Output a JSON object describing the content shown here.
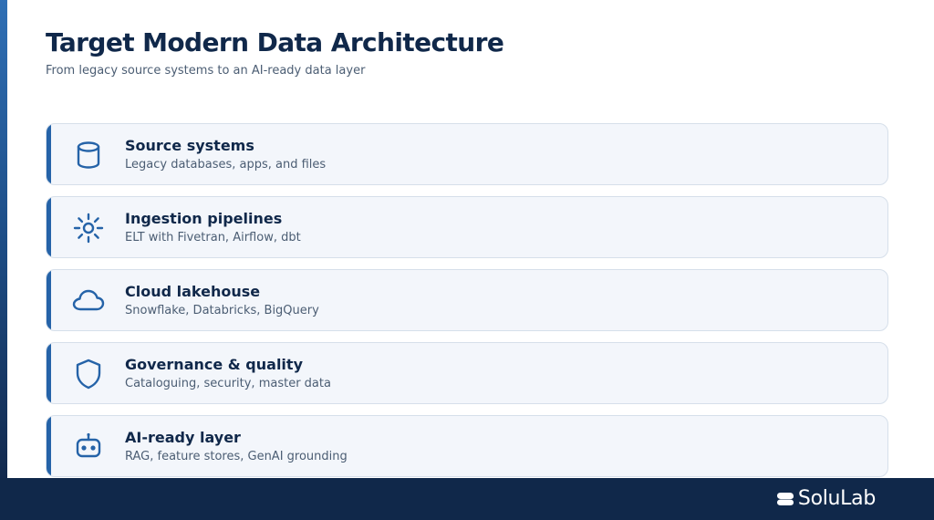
{
  "header": {
    "title": "Target Modern Data Architecture",
    "subtitle": "From legacy source systems to an AI-ready data layer"
  },
  "layers": [
    {
      "icon": "database-icon",
      "title": "Source systems",
      "description": "Legacy databases, apps, and files"
    },
    {
      "icon": "gear-icon",
      "title": "Ingestion pipelines",
      "description": "ELT with Fivetran, Airflow, dbt"
    },
    {
      "icon": "cloud-icon",
      "title": "Cloud lakehouse",
      "description": "Snowflake, Databricks, BigQuery"
    },
    {
      "icon": "shield-icon",
      "title": "Governance & quality",
      "description": "Cataloguing, security, master data"
    },
    {
      "icon": "robot-icon",
      "title": "AI-ready layer",
      "description": "RAG, feature stores, GenAI grounding"
    }
  ],
  "footer": {
    "brand": "SoluLab"
  },
  "colors": {
    "accent": "#2563a8",
    "navy": "#10284a",
    "card_background": "#f3f6fb"
  }
}
